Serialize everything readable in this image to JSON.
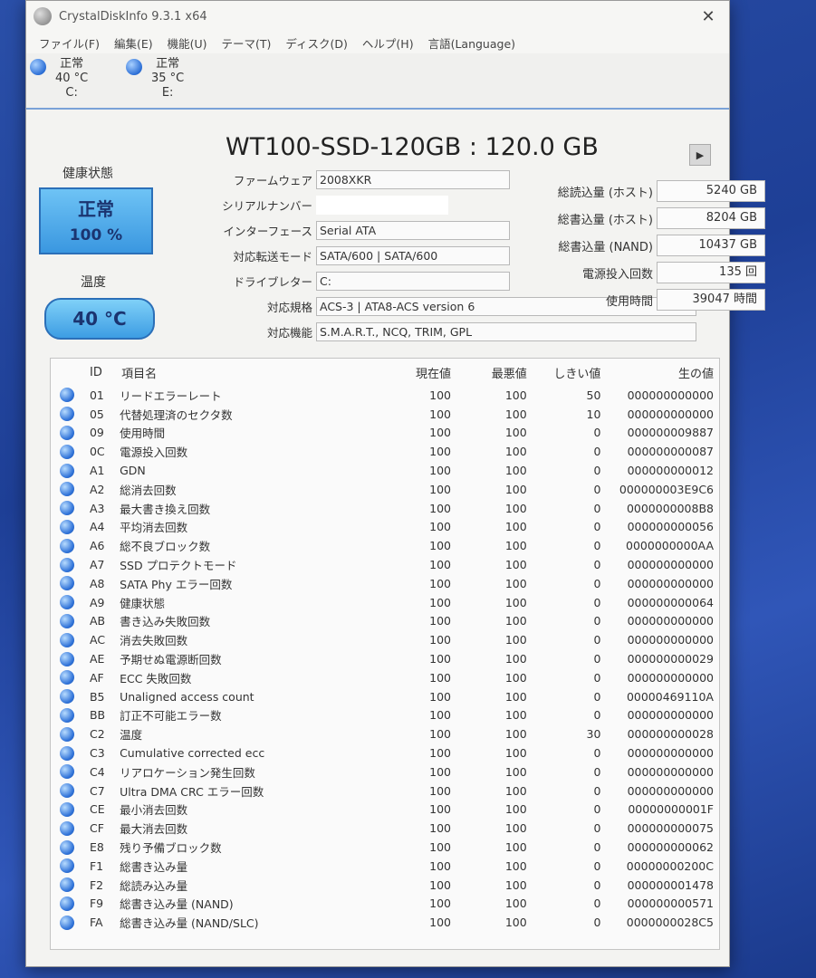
{
  "window": {
    "title": "CrystalDiskInfo 9.3.1 x64",
    "close": "✕"
  },
  "menu": [
    "ファイル(F)",
    "編集(E)",
    "機能(U)",
    "テーマ(T)",
    "ディスク(D)",
    "ヘルプ(H)",
    "言語(Language)"
  ],
  "drives": [
    {
      "status": "正常",
      "temp": "40 °C",
      "letter": "C:"
    },
    {
      "status": "正常",
      "temp": "35 °C",
      "letter": "E:"
    }
  ],
  "disk": {
    "title": "WT100-SSD-120GB : 120.0 GB",
    "health_label": "健康状態",
    "health_status": "正常",
    "health_percent": "100 %",
    "temp_label": "温度",
    "temp_value": "40 °C",
    "info": [
      {
        "label": "ファームウェア",
        "value": "2008XKR"
      },
      {
        "label": "シリアルナンバー",
        "value": ""
      },
      {
        "label": "インターフェース",
        "value": "Serial ATA"
      },
      {
        "label": "対応転送モード",
        "value": "SATA/600 | SATA/600"
      },
      {
        "label": "ドライブレター",
        "value": "C:"
      },
      {
        "label": "対応規格",
        "value": "ACS-3 | ATA8-ACS version 6"
      },
      {
        "label": "対応機能",
        "value": "S.M.A.R.T., NCQ, TRIM, GPL"
      }
    ],
    "stats": [
      {
        "label": "総読込量 (ホスト)",
        "value": "5240 GB"
      },
      {
        "label": "総書込量 (ホスト)",
        "value": "8204 GB"
      },
      {
        "label": "総書込量 (NAND)",
        "value": "10437 GB"
      },
      {
        "label": "電源投入回数",
        "value": "135 回"
      },
      {
        "label": "使用時間",
        "value": "39047 時間"
      }
    ]
  },
  "smart": {
    "headers": {
      "id": "ID",
      "name": "項目名",
      "current": "現在値",
      "worst": "最悪値",
      "threshold": "しきい値",
      "raw": "生の値"
    },
    "rows": [
      {
        "id": "01",
        "name": "リードエラーレート",
        "current": "100",
        "worst": "100",
        "threshold": "50",
        "raw": "000000000000"
      },
      {
        "id": "05",
        "name": "代替処理済のセクタ数",
        "current": "100",
        "worst": "100",
        "threshold": "10",
        "raw": "000000000000"
      },
      {
        "id": "09",
        "name": "使用時間",
        "current": "100",
        "worst": "100",
        "threshold": "0",
        "raw": "000000009887"
      },
      {
        "id": "0C",
        "name": "電源投入回数",
        "current": "100",
        "worst": "100",
        "threshold": "0",
        "raw": "000000000087"
      },
      {
        "id": "A1",
        "name": "GDN",
        "current": "100",
        "worst": "100",
        "threshold": "0",
        "raw": "000000000012"
      },
      {
        "id": "A2",
        "name": "総消去回数",
        "current": "100",
        "worst": "100",
        "threshold": "0",
        "raw": "000000003E9C6"
      },
      {
        "id": "A3",
        "name": "最大書き換え回数",
        "current": "100",
        "worst": "100",
        "threshold": "0",
        "raw": "0000000008B8"
      },
      {
        "id": "A4",
        "name": "平均消去回数",
        "current": "100",
        "worst": "100",
        "threshold": "0",
        "raw": "000000000056"
      },
      {
        "id": "A6",
        "name": "総不良ブロック数",
        "current": "100",
        "worst": "100",
        "threshold": "0",
        "raw": "0000000000AA"
      },
      {
        "id": "A7",
        "name": "SSD プロテクトモード",
        "current": "100",
        "worst": "100",
        "threshold": "0",
        "raw": "000000000000"
      },
      {
        "id": "A8",
        "name": "SATA Phy エラー回数",
        "current": "100",
        "worst": "100",
        "threshold": "0",
        "raw": "000000000000"
      },
      {
        "id": "A9",
        "name": "健康状態",
        "current": "100",
        "worst": "100",
        "threshold": "0",
        "raw": "000000000064"
      },
      {
        "id": "AB",
        "name": "書き込み失敗回数",
        "current": "100",
        "worst": "100",
        "threshold": "0",
        "raw": "000000000000"
      },
      {
        "id": "AC",
        "name": "消去失敗回数",
        "current": "100",
        "worst": "100",
        "threshold": "0",
        "raw": "000000000000"
      },
      {
        "id": "AE",
        "name": "予期せぬ電源断回数",
        "current": "100",
        "worst": "100",
        "threshold": "0",
        "raw": "000000000029"
      },
      {
        "id": "AF",
        "name": "ECC 失敗回数",
        "current": "100",
        "worst": "100",
        "threshold": "0",
        "raw": "000000000000"
      },
      {
        "id": "B5",
        "name": "Unaligned access count",
        "current": "100",
        "worst": "100",
        "threshold": "0",
        "raw": "00000469110A"
      },
      {
        "id": "BB",
        "name": "訂正不可能エラー数",
        "current": "100",
        "worst": "100",
        "threshold": "0",
        "raw": "000000000000"
      },
      {
        "id": "C2",
        "name": "温度",
        "current": "100",
        "worst": "100",
        "threshold": "30",
        "raw": "000000000028"
      },
      {
        "id": "C3",
        "name": "Cumulative corrected ecc",
        "current": "100",
        "worst": "100",
        "threshold": "0",
        "raw": "000000000000"
      },
      {
        "id": "C4",
        "name": "リアロケーション発生回数",
        "current": "100",
        "worst": "100",
        "threshold": "0",
        "raw": "000000000000"
      },
      {
        "id": "C7",
        "name": "Ultra DMA CRC エラー回数",
        "current": "100",
        "worst": "100",
        "threshold": "0",
        "raw": "000000000000"
      },
      {
        "id": "CE",
        "name": "最小消去回数",
        "current": "100",
        "worst": "100",
        "threshold": "0",
        "raw": "00000000001F"
      },
      {
        "id": "CF",
        "name": "最大消去回数",
        "current": "100",
        "worst": "100",
        "threshold": "0",
        "raw": "000000000075"
      },
      {
        "id": "E8",
        "name": "残り予備ブロック数",
        "current": "100",
        "worst": "100",
        "threshold": "0",
        "raw": "000000000062"
      },
      {
        "id": "F1",
        "name": "総書き込み量",
        "current": "100",
        "worst": "100",
        "threshold": "0",
        "raw": "00000000200C"
      },
      {
        "id": "F2",
        "name": "総読み込み量",
        "current": "100",
        "worst": "100",
        "threshold": "0",
        "raw": "000000001478"
      },
      {
        "id": "F9",
        "name": "総書き込み量 (NAND)",
        "current": "100",
        "worst": "100",
        "threshold": "0",
        "raw": "000000000571"
      },
      {
        "id": "FA",
        "name": "総書き込み量 (NAND/SLC)",
        "current": "100",
        "worst": "100",
        "threshold": "0",
        "raw": "0000000028C5"
      }
    ]
  }
}
